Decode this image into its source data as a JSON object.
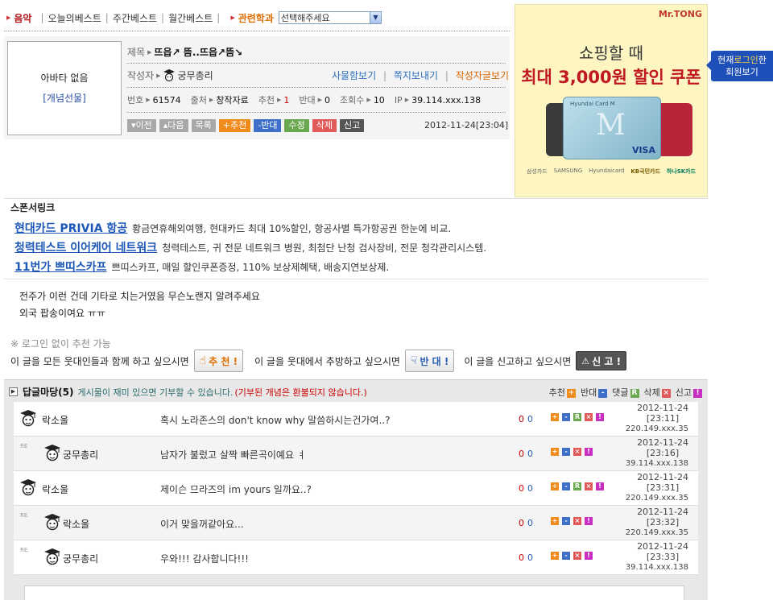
{
  "nav": {
    "music": "음악",
    "items": [
      "오늘의베스트",
      "주간베스트",
      "월간베스트"
    ],
    "related_label": "관련학과",
    "select_value": "선택해주세요"
  },
  "post": {
    "avatar_text": "아바타 없음",
    "avatar_link": "[개념선물]",
    "title_label": "제목",
    "title": "뜨읍↗ 뜸..뜨읍↗뜸↘",
    "author_label": "작성자",
    "author": "궁무총리",
    "links": [
      "사물함보기",
      "쪽지보내기",
      "작성자글보기"
    ],
    "info": [
      {
        "label": "번호",
        "value": "61574"
      },
      {
        "label": "출처",
        "value": "창작자료"
      },
      {
        "label": "추천",
        "value": "1",
        "highlight": true
      },
      {
        "label": "반대",
        "value": "0"
      },
      {
        "label": "조회수",
        "value": "10"
      },
      {
        "label": "IP",
        "value": "39.114.xxx.138"
      }
    ],
    "buttons": [
      {
        "label": "▾이전",
        "kind": "gray"
      },
      {
        "label": "▴다음",
        "kind": "gray"
      },
      {
        "label": "목록",
        "kind": "gray"
      },
      {
        "label": "+추천",
        "kind": "orange"
      },
      {
        "label": "-반대",
        "kind": "blue"
      },
      {
        "label": "수정",
        "kind": "green"
      },
      {
        "label": "삭제",
        "kind": "red"
      },
      {
        "label": "신고",
        "kind": "dark"
      }
    ],
    "date": "2012-11-24[23:04]"
  },
  "ad": {
    "brand": "Mr.TONG",
    "line1": "쇼핑할 때",
    "line2": "최대 3,000원 할인 쿠폰",
    "card_tag": "Hyundai Card M",
    "card_visa": "VISA",
    "logos": [
      "삼성카드",
      "SAMSUNG",
      "Hyundaicard",
      "KB국민카드",
      "하나SK카드"
    ]
  },
  "side_popup": {
    "line1_pre": "현재",
    "line1_hl": "로그인",
    "line1_post": "한",
    "line2": "회원보기"
  },
  "sponsor": {
    "title": "스폰서링크",
    "links": [
      {
        "link": "현대카드 PRIVIA 항공",
        "desc": "황금연휴해외여행, 현대카드 최대 10%할인, 항공사별 특가항공권 한눈에 비교."
      },
      {
        "link": "청력테스트 이어케어 네트워크",
        "desc": "청력테스트, 귀 전문 네트워크 병원, 최첨단 난청 검사장비, 전문 청각관리시스템."
      },
      {
        "link": "11번가 쁘띠스카프",
        "desc": "쁘띠스카프, 매일 할인쿠폰증정, 110% 보상제혜택, 배송지연보상제."
      }
    ]
  },
  "body": {
    "lines": [
      "전주가 이런 건데 기타로 치는거였음 무슨노랜지 알려주세요",
      "외국 팝송이여요 ㅠㅠ"
    ]
  },
  "recommend": {
    "note": "※ 로그인 없이 추천 가능",
    "text1": "이 글을 모든 웃대인들과 함께 하고 싶으시면",
    "btn1": "추 천 !",
    "text2": "이 글을 웃대에서 추방하고 싶으시면",
    "btn2": "반 대 !",
    "text3": "이 글을 신고하고 싶으시면",
    "btn3": "신 고 !"
  },
  "replies": {
    "title": "답글마당(5)",
    "note_green": "게시물이 재미 있으면 기부할 수 있습니다.",
    "note_red": "(기부된 개념은 환불되지 않습니다.)",
    "legend": [
      {
        "label": "추천",
        "sym": "+",
        "kind": "o"
      },
      {
        "label": "반대",
        "sym": "-",
        "kind": "b"
      },
      {
        "label": "댓글",
        "sym": "R",
        "kind": "g"
      },
      {
        "label": "삭제",
        "sym": "×",
        "kind": "r"
      },
      {
        "label": "신고",
        "sym": "!",
        "kind": "p"
      }
    ],
    "re_tag": "RE",
    "items": [
      {
        "nick": "락소울",
        "msg": "혹시 노라존스의 don't know why 말씀하시는건가여..?",
        "up": "0",
        "down": "0",
        "date": "2012-11-24",
        "time": "[23:11]",
        "ip": "220.149.xxx.35",
        "reply": false
      },
      {
        "nick": "궁무총리",
        "msg": "남자가 불렀고 살짝 빠른곡이예요 ㅕ",
        "up": "0",
        "down": "0",
        "date": "2012-11-24",
        "time": "[23:16]",
        "ip": "39.114.xxx.138",
        "reply": true
      },
      {
        "nick": "락소울",
        "msg": "제이슨 므라즈의 im yours 일까요..?",
        "up": "0",
        "down": "0",
        "date": "2012-11-24",
        "time": "[23:31]",
        "ip": "220.149.xxx.35",
        "reply": false
      },
      {
        "nick": "락소울",
        "msg": "이거 맞을꺼같아요...",
        "up": "0",
        "down": "0",
        "date": "2012-11-24",
        "time": "[23:32]",
        "ip": "220.149.xxx.35",
        "reply": true
      },
      {
        "nick": "궁무총리",
        "msg": "우와!!! 감사합니다!!!",
        "up": "0",
        "down": "0",
        "date": "2012-11-24",
        "time": "[23:33]",
        "ip": "39.114.xxx.138",
        "reply": true
      }
    ]
  }
}
